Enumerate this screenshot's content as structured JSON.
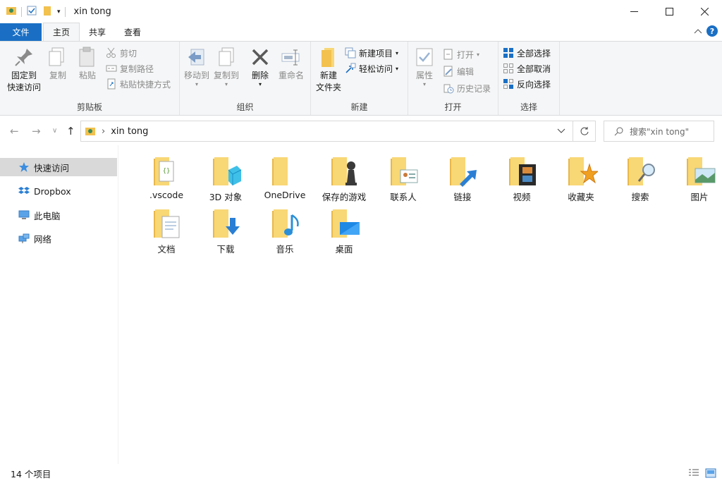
{
  "window": {
    "title": "xin tong"
  },
  "tabs": {
    "file": "文件",
    "home": "主页",
    "share": "共享",
    "view": "查看"
  },
  "ribbon": {
    "clipboard": {
      "pin": "固定到\n快速访问",
      "copy": "复制",
      "paste": "粘贴",
      "cut": "剪切",
      "copy_path": "复制路径",
      "paste_shortcut": "粘贴快捷方式",
      "label": "剪贴板"
    },
    "organize": {
      "move_to": "移动到",
      "copy_to": "复制到",
      "delete": "删除",
      "rename": "重命名",
      "label": "组织"
    },
    "new": {
      "new_folder": "新建\n文件夹",
      "new_item": "新建项目",
      "easy_access": "轻松访问",
      "label": "新建"
    },
    "open": {
      "properties": "属性",
      "open": "打开",
      "edit": "编辑",
      "history": "历史记录",
      "label": "打开"
    },
    "select": {
      "select_all": "全部选择",
      "select_none": "全部取消",
      "invert": "反向选择",
      "label": "选择"
    }
  },
  "address": {
    "path": "xin tong",
    "search_placeholder": "搜索\"xin tong\""
  },
  "nav": {
    "items": [
      {
        "label": "快速访问",
        "icon": "star-icon"
      },
      {
        "label": "Dropbox",
        "icon": "dropbox-icon"
      },
      {
        "label": "此电脑",
        "icon": "computer-icon"
      },
      {
        "label": "网络",
        "icon": "network-icon"
      }
    ]
  },
  "folders": [
    {
      "label": ".vscode",
      "overlay": "vscode-doc"
    },
    {
      "label": "3D 对象",
      "overlay": "cube"
    },
    {
      "label": "OneDrive",
      "overlay": "none"
    },
    {
      "label": "保存的游戏",
      "overlay": "chess"
    },
    {
      "label": "联系人",
      "overlay": "contact"
    },
    {
      "label": "链接",
      "overlay": "arrow"
    },
    {
      "label": "视频",
      "overlay": "film"
    },
    {
      "label": "收藏夹",
      "overlay": "star"
    },
    {
      "label": "搜索",
      "overlay": "magnifier"
    },
    {
      "label": "图片",
      "overlay": "picture"
    },
    {
      "label": "文档",
      "overlay": "document"
    },
    {
      "label": "下载",
      "overlay": "download"
    },
    {
      "label": "音乐",
      "overlay": "music"
    },
    {
      "label": "桌面",
      "overlay": "desktop"
    }
  ],
  "status": {
    "count": "14 个项目"
  },
  "colors": {
    "accent": "#1a6fc4",
    "folder": "#f8d775",
    "folder_dark": "#e8b84a"
  }
}
